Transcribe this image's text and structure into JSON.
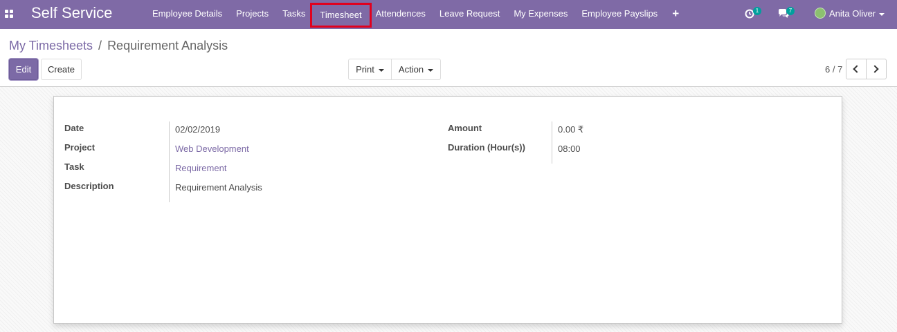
{
  "navbar": {
    "brand": "Self Service",
    "menu": [
      "Employee Details",
      "Projects",
      "Tasks",
      "Timesheet",
      "Attendences",
      "Leave Request",
      "My Expenses",
      "Employee Payslips"
    ],
    "add_icon": "plus-icon",
    "systray": {
      "activity_count": "1",
      "messages_count": "7",
      "user_name": "Anita Oliver"
    },
    "colors": {
      "navbar": "#7f6aa6",
      "highlight_border": "#e1001e",
      "badge": "#00a09d"
    }
  },
  "control_panel": {
    "breadcrumb": {
      "parent": "My Timesheets",
      "separator": "/",
      "current": "Requirement Analysis"
    },
    "edit_label": "Edit",
    "create_label": "Create",
    "print_label": "Print",
    "action_label": "Action",
    "pager": "6 / 7"
  },
  "form": {
    "left": [
      {
        "label": "Date",
        "value": "02/02/2019"
      },
      {
        "label": "Project",
        "value": "Web Development"
      },
      {
        "label": "Task",
        "value": "Requirement"
      },
      {
        "label": "Description",
        "value": "Requirement Analysis"
      }
    ],
    "right": [
      {
        "label": "Amount",
        "value": "0.00 ₹"
      },
      {
        "label": "Duration (Hour(s))",
        "value": "08:00"
      }
    ]
  }
}
